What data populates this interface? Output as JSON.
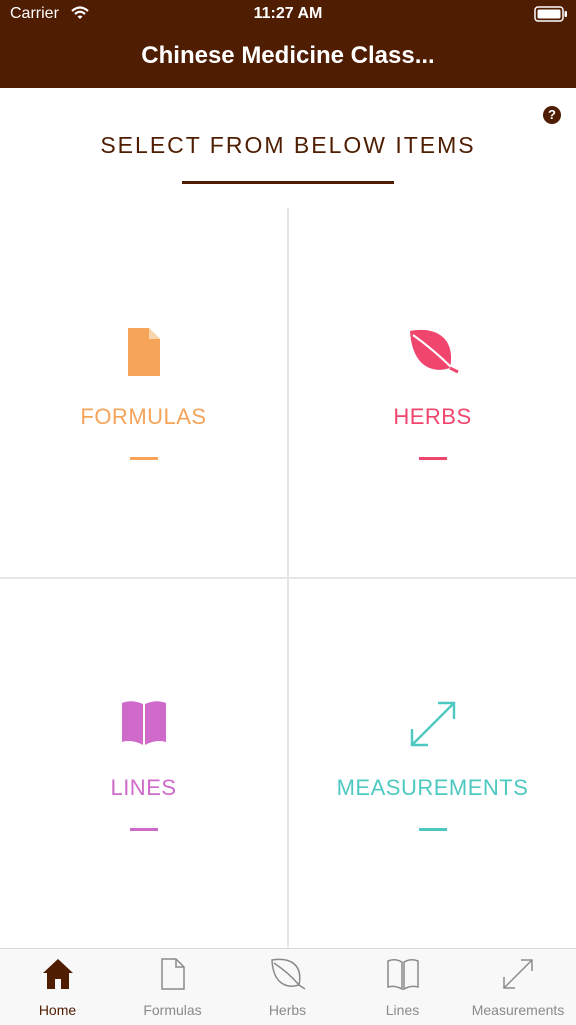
{
  "status_bar": {
    "carrier": "Carrier",
    "time": "11:27 AM"
  },
  "nav": {
    "title": "Chinese Medicine Class..."
  },
  "help": {
    "label": "?"
  },
  "heading": "SELECT FROM BELOW ITEMS",
  "colors": {
    "brand": "#4f1d02",
    "formulas": "#f6a45a",
    "herbs": "#f0466e",
    "lines": "#cf6acb",
    "measurements": "#4ec9c2",
    "tab_inactive": "#8a8a8a"
  },
  "cells": [
    {
      "label": "FORMULAS",
      "icon": "document-icon"
    },
    {
      "label": "HERBS",
      "icon": "leaf-icon"
    },
    {
      "label": "LINES",
      "icon": "book-icon"
    },
    {
      "label": "MEASUREMENTS",
      "icon": "resize-arrows-icon"
    }
  ],
  "tabs": [
    {
      "label": "Home",
      "icon": "home-icon",
      "active": true
    },
    {
      "label": "Formulas",
      "icon": "document-icon",
      "active": false
    },
    {
      "label": "Herbs",
      "icon": "leaf-icon",
      "active": false
    },
    {
      "label": "Lines",
      "icon": "book-icon",
      "active": false
    },
    {
      "label": "Measurements",
      "icon": "resize-arrows-icon",
      "active": false
    }
  ]
}
